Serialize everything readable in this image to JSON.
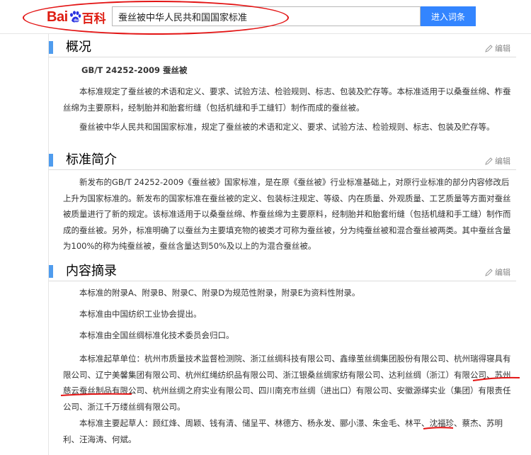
{
  "header": {
    "logo_bai": "Bai",
    "logo_baike": "百科",
    "search_value": "蚕丝被中华人民共和国国家标准",
    "enter_button": "进入词条"
  },
  "edit_label": "编辑",
  "sections": {
    "overview": {
      "title": "概况",
      "subtitle": "GB/T 24252-2009 蚕丝被",
      "p1": "本标准规定了蚕丝被的术语和定义、要求、试验方法、检验规则、标志、包装及贮存等。本标准适用于以桑蚕丝绵、柞蚕丝绵为主要原料，经制胎并和胎套绗缝（包括机缝和手工缝钉）制作而成的蚕丝被。",
      "p2": "蚕丝被中华人民共和国国家标准，规定了蚕丝被的术语和定义、要求、试验方法、检验规则、标志、包装及贮存等。"
    },
    "intro": {
      "title": "标准简介",
      "p1": "新发布的GB/T 24252-2009《蚕丝被》国家标准，是在原《蚕丝被》行业标准基础上，对原行业标准的部分内容修改后上升为国家标准的。新发布的国家标准在蚕丝被的定义、包装标注规定、等级、内在质量、外观质量、工艺质量等方面对蚕丝被质量进行了新的规定。该标准适用于以桑蚕丝绵、柞蚕丝绵为主要原料，经制胎并和胎套绗缝（包括机缝和手工缝）制作而成的蚕丝被。另外，标准明确了以蚕丝为主要填充物的被类才可称为蚕丝被，分为纯蚕丝被和混合蚕丝被两类。其中蚕丝含量为100%的称为纯蚕丝被，蚕丝含量达到50%及以上的为混合蚕丝被。"
    },
    "summary": {
      "title": "内容摘录",
      "p1": "本标准的附录A、附录B、附录C、附录D为规范性附录，附录E为资料性附录。",
      "p2": "本标准由中国纺织工业协会提出。",
      "p3": "本标准由全国丝绸标准化技术委员会归口。",
      "p4": "本标准起草单位：杭州市质量技术监督检测院、浙江丝绸科技有限公司、鑫缘茧丝绸集团股份有限公司、杭州瑞得寝具有限公司、辽宁美馨集团有限公司、杭州红绳纺织品有限公司、浙江银桑丝绸家纺有限公司、达利丝绸（浙江）有限公司、苏州慈云蚕丝制品有限公司、杭州丝绸之府实业有限公司、四川南充市丝绸（进出口）有限公司、安徽源缂实业（集团）有限责任公司、浙江千万缕丝绸有限公司。",
      "p5": "本标准主要起草人：顾红烽、周颖、钱有清、储呈平、林德方、杨永发、郦小澋、朱金毛、林平、沈福珍、蔡杰、苏明利、汪海涛、何斌。"
    }
  },
  "colors": {
    "brand_red": "#de1d12",
    "button_blue": "#3385ff",
    "section_bar": "#4f9cee",
    "annotation_red": "#e31414"
  }
}
